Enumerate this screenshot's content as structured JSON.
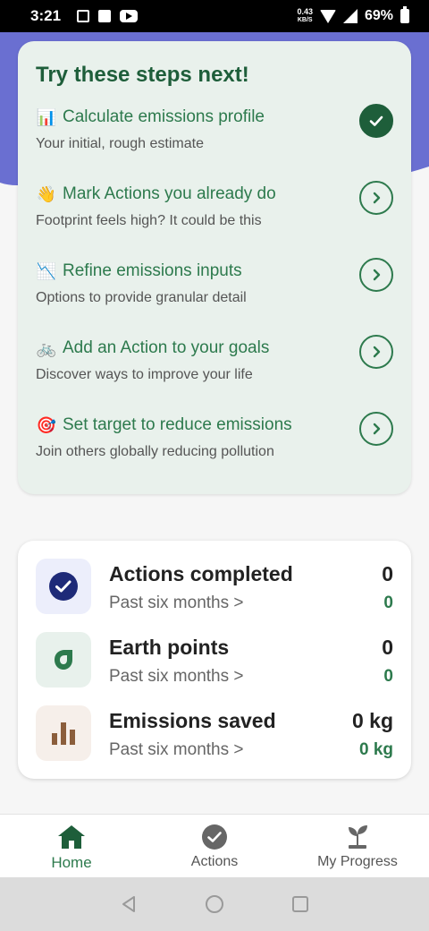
{
  "status_bar": {
    "time": "3:21",
    "net_speed_value": "0.43",
    "net_speed_unit": "KB/S",
    "battery": "69%"
  },
  "steps_card": {
    "title": "Try these steps next!",
    "steps": [
      {
        "emoji": "📊",
        "title": "Calculate emissions profile",
        "subtitle": "Your initial, rough estimate",
        "completed": true
      },
      {
        "emoji": "👋",
        "title": "Mark Actions you already do",
        "subtitle": "Footprint feels high? It could be this",
        "completed": false
      },
      {
        "emoji": "📉",
        "title": "Refine emissions inputs",
        "subtitle": "Options to provide granular detail",
        "completed": false
      },
      {
        "emoji": "🚲",
        "title": "Add an Action to your goals",
        "subtitle": "Discover ways to improve your life",
        "completed": false
      },
      {
        "emoji": "🎯",
        "title": "Set target to reduce emissions",
        "subtitle": "Join others globally reducing pollution",
        "completed": false
      }
    ]
  },
  "stats_card": {
    "rows": [
      {
        "title": "Actions completed",
        "subtitle": "Past six months >",
        "value": "0",
        "subvalue": "0",
        "icon": "check-circle-icon"
      },
      {
        "title": "Earth points",
        "subtitle": "Past six months >",
        "value": "0",
        "subvalue": "0",
        "icon": "earth-points-icon"
      },
      {
        "title": "Emissions saved",
        "subtitle": "Past six months >",
        "value": "0 kg",
        "subvalue": "0 kg",
        "icon": "bar-chart-icon"
      }
    ]
  },
  "bottom_nav": {
    "items": [
      {
        "label": "Home",
        "icon": "home-icon",
        "active": true
      },
      {
        "label": "Actions",
        "icon": "check-circle-icon",
        "active": false
      },
      {
        "label": "My Progress",
        "icon": "sprout-icon",
        "active": false
      }
    ]
  },
  "colors": {
    "brand_green": "#2d7a4d",
    "dark_green": "#1e5e3a",
    "purple": "#6a6fd1",
    "card_bg": "#e9f1ec"
  }
}
